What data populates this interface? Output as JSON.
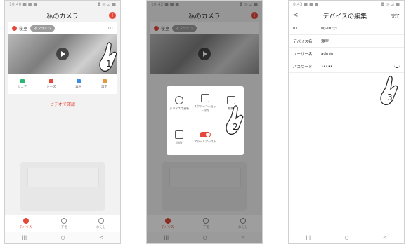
{
  "screen1": {
    "status_left": "10:40 ■ ■ ■ ·",
    "status_right": "◘ ◎ ⊿ ■",
    "title": "私のカメラ",
    "device_name": "寝室",
    "online_badge": "オンライン",
    "more": "···",
    "actions": [
      {
        "label": "シェア",
        "icon": "share-icon",
        "color": "#2bb673"
      },
      {
        "label": "シーズ",
        "icon": "cloud-icon",
        "color": "#e5483a"
      },
      {
        "label": "再生",
        "icon": "playback-icon",
        "color": "#3b8be5"
      },
      {
        "label": "設定",
        "icon": "settings-icon",
        "color": "#e59a3a"
      }
    ],
    "link": "ビデオで確認",
    "tabs": [
      {
        "label": "デバイス",
        "icon": "device-icon"
      },
      {
        "label": "デモ",
        "icon": "demo-icon"
      },
      {
        "label": "わたし",
        "icon": "profile-icon"
      }
    ],
    "hand_number": "1"
  },
  "screen2": {
    "status_left": "10:42 ■ ■ ■ ·",
    "status_right": "◘ ◎ ⊿ ■",
    "title": "私のカメラ",
    "device_name": "寝室",
    "online_badge": "オンライン",
    "popup": [
      {
        "label": "デバイスの更新",
        "icon": "upload-icon"
      },
      {
        "label": "スクリーンショット保存",
        "icon": "image-icon"
      },
      {
        "label": "編集",
        "icon": "edit-icon"
      },
      {
        "label": "削除",
        "icon": "trash-icon"
      },
      {
        "label": "アラームアシスト",
        "icon": "toggle-icon"
      },
      {
        "label": "",
        "icon": ""
      }
    ],
    "tabs": [
      {
        "label": "デバイス"
      },
      {
        "label": "デモ"
      },
      {
        "label": "わたし"
      }
    ],
    "hand_number": "2"
  },
  "screen3": {
    "status_left": "0:43 ■ ■ ■ ·",
    "status_right": "◘ ◎ ⊿ ■",
    "back": "<",
    "title": "デバイスの編集",
    "done": "完了",
    "rows": [
      {
        "key": "ID",
        "value": "Ⅲ▷ⅡⅢ◁▷"
      },
      {
        "key": "デバイス名",
        "value": "寝室"
      },
      {
        "key": "ユーザー名",
        "value": "admin"
      },
      {
        "key": "パスワード",
        "value": "•••••"
      }
    ],
    "hand_number": "3"
  },
  "navbar": [
    "|||",
    "○",
    "<"
  ]
}
